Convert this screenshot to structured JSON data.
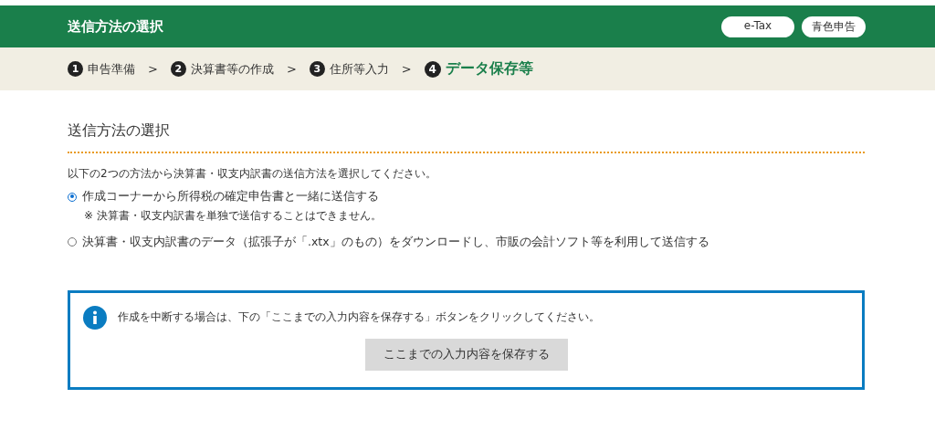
{
  "header": {
    "title": "送信方法の選択",
    "badges": [
      "e-Tax",
      "青色申告"
    ]
  },
  "steps": [
    {
      "number": "1",
      "label": "申告準備",
      "selected": false,
      "separator": ">"
    },
    {
      "number": "2",
      "label": "決算書等の作成",
      "selected": false,
      "separator": ">"
    },
    {
      "number": "3",
      "label": "住所等入力",
      "selected": false,
      "separator": ">"
    },
    {
      "number": "4",
      "label": "データ保存等",
      "selected": true
    }
  ],
  "section": {
    "heading": "送信方法の選択",
    "description": "以下の2つの方法から決算書・収支内訳書の送信方法を選択してください。",
    "options": [
      {
        "label": "作成コーナーから所得税の確定申告書と一緒に送信する",
        "selected": true,
        "note": "※ 決算書・収支内訳書を単独で送信することはできません。"
      },
      {
        "label": "決算書・収支内訳書のデータ（拡張子が「.xtx」のもの）をダウンロードし、市販の会計ソフト等を利用して送信する",
        "selected": false
      }
    ]
  },
  "info": {
    "message": "作成を中断する場合は、下の「ここまでの入力内容を保存する」ボタンをクリックしてください。",
    "button": "ここまでの入力内容を保存する"
  }
}
